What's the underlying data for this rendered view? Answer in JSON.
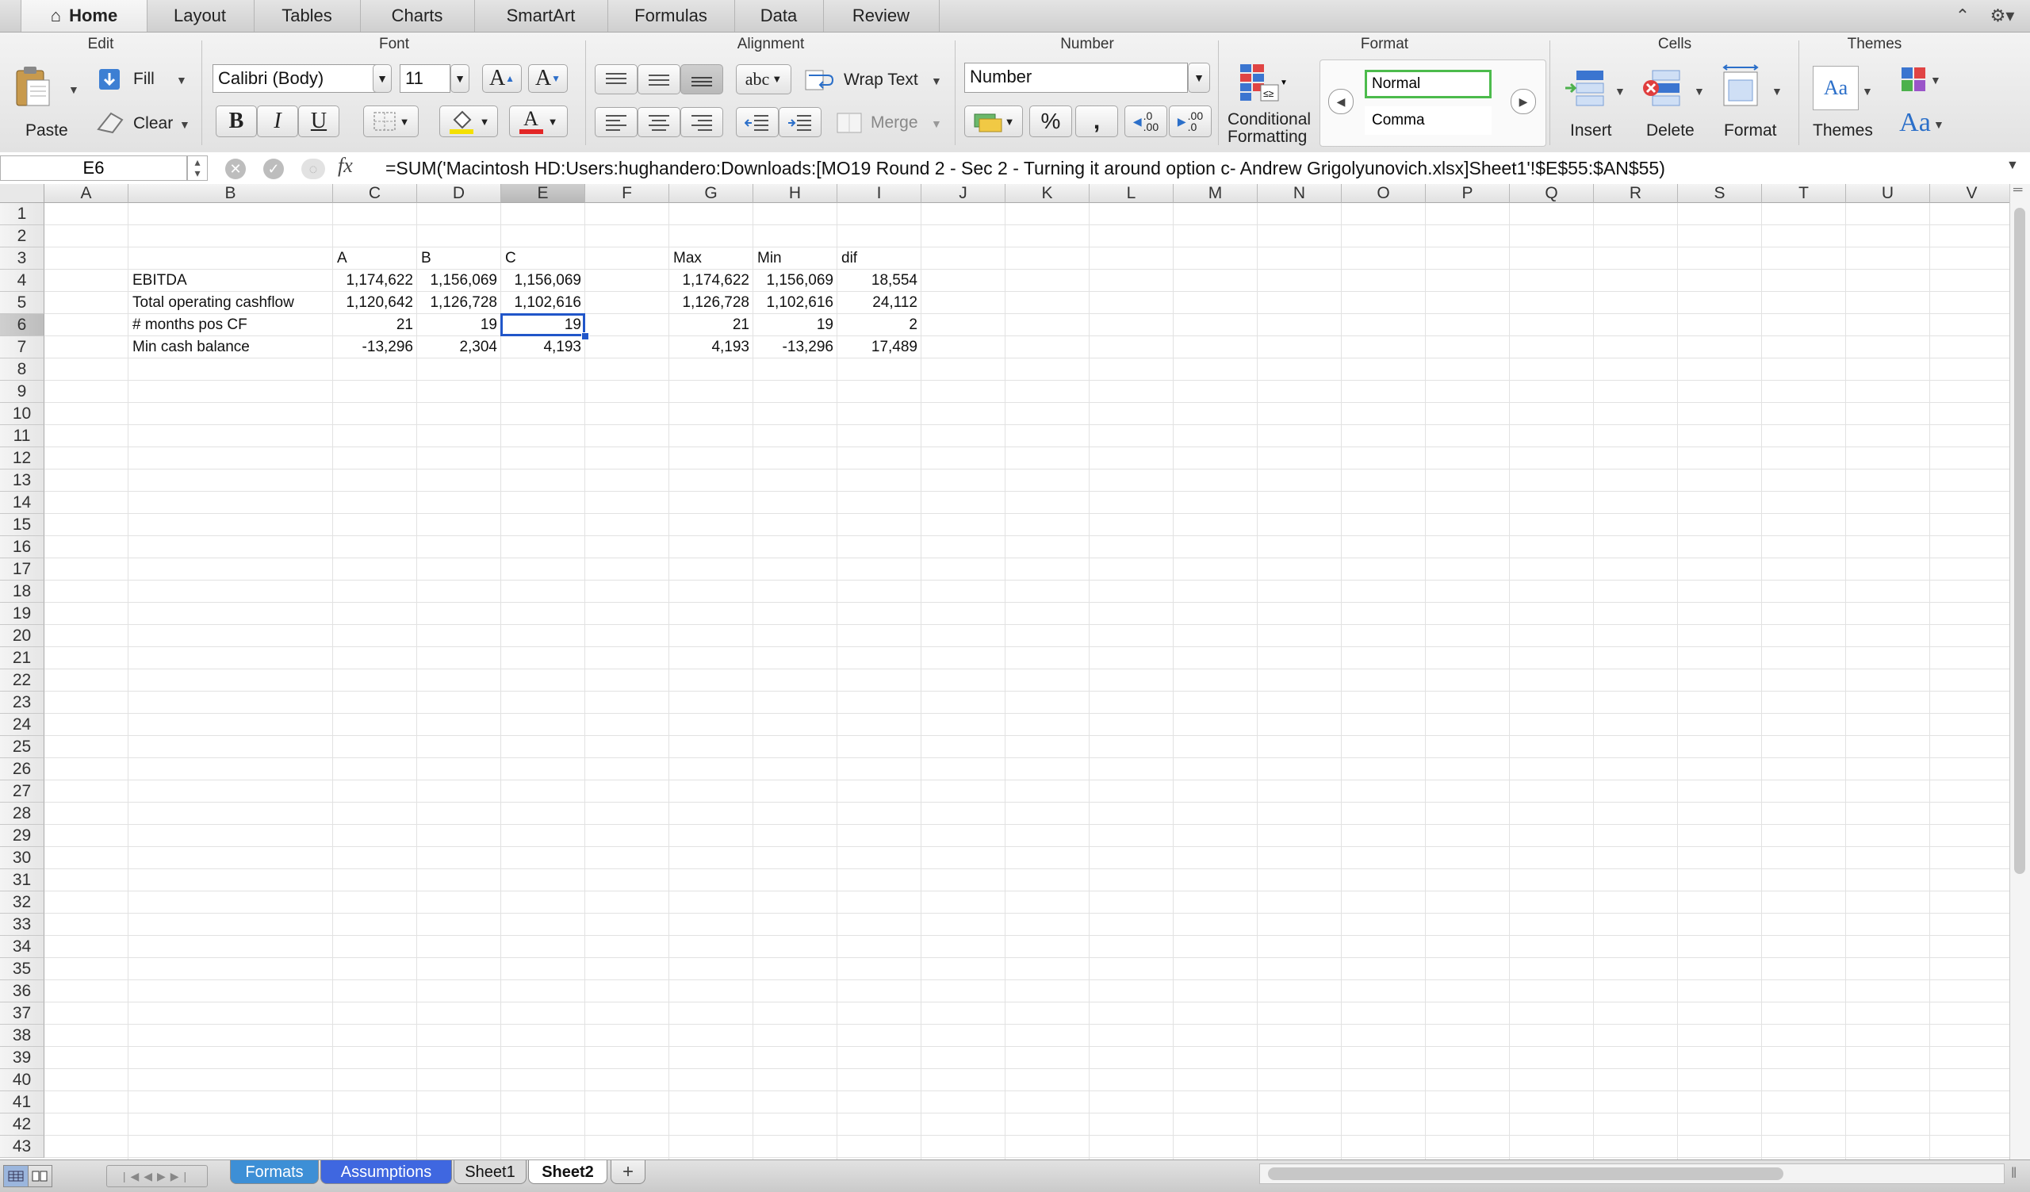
{
  "ribbon_tabs": [
    "Home",
    "Layout",
    "Tables",
    "Charts",
    "SmartArt",
    "Formulas",
    "Data",
    "Review"
  ],
  "active_tab": "Home",
  "groups": {
    "edit": {
      "title": "Edit",
      "paste": "Paste",
      "fill": "Fill",
      "clear": "Clear"
    },
    "font": {
      "title": "Font",
      "font_name": "Calibri (Body)",
      "font_size": "11",
      "bold": "B",
      "italic": "I",
      "underline": "U",
      "grow": "A",
      "shrink": "A",
      "font_color_letter": "A"
    },
    "alignment": {
      "title": "Alignment",
      "wrap_text": "Wrap Text",
      "merge": "Merge",
      "orientation": "abc"
    },
    "number": {
      "title": "Number",
      "format": "Number",
      "percent": "%",
      "comma": ",",
      "inc_decimal": ".0\n.00",
      "dec_decimal": ".00\n.0"
    },
    "format": {
      "title": "Format",
      "conditional": "Conditional",
      "formatting": "Formatting",
      "style_normal": "Normal",
      "style_comma": "Comma"
    },
    "cells": {
      "title": "Cells",
      "insert": "Insert",
      "delete": "Delete",
      "format": "Format"
    },
    "themes": {
      "title": "Themes",
      "themes": "Themes",
      "sample": "Aa",
      "fonts": "Aa"
    }
  },
  "formula_bar": {
    "name_box": "E6",
    "fx": "fx",
    "formula": "=SUM('Macintosh HD:Users:hughandero:Downloads:[MO19 Round 2 - Sec 2 - Turning it around option c- Andrew Grigolyunovich.xlsx]Sheet1'!$E$55:$AN$55)"
  },
  "columns": [
    "A",
    "B",
    "C",
    "D",
    "E",
    "F",
    "G",
    "H",
    "I",
    "J",
    "K",
    "L",
    "M",
    "N",
    "O",
    "P",
    "Q",
    "R",
    "S",
    "T",
    "U",
    "V"
  ],
  "row_count": 43,
  "selected_cell": {
    "col": "E",
    "row": 6
  },
  "cells": {
    "C3": "A",
    "D3": "B",
    "E3": "C",
    "G3": "Max",
    "H3": "Min",
    "I3": "dif",
    "B4": "EBITDA",
    "C4": "1,174,622",
    "D4": "1,156,069",
    "E4": "1,156,069",
    "G4": "1,174,622",
    "H4": "1,156,069",
    "I4": "18,554",
    "B5": "Total operating cashflow",
    "C5": "1,120,642",
    "D5": "1,126,728",
    "E5": "1,102,616",
    "G5": "1,126,728",
    "H5": "1,102,616",
    "I5": "24,112",
    "B6": "# months pos CF",
    "C6": "21",
    "D6": "19",
    "E6": "19",
    "G6": "21",
    "H6": "19",
    "I6": "2",
    "B7": "Min cash balance",
    "C7": "-13,296",
    "D7": "2,304",
    "E7": "4,193",
    "G7": "4,193",
    "H7": "-13,296",
    "I7": "17,489"
  },
  "text_cells": [
    "C3",
    "D3",
    "E3",
    "G3",
    "H3",
    "I3",
    "B4",
    "B5",
    "B6",
    "B7"
  ],
  "sheet_tabs": [
    {
      "label": "Formats",
      "color": "#3d8fd6"
    },
    {
      "label": "Assumptions",
      "color": "#3f67e0"
    },
    {
      "label": "Sheet1",
      "color": "#dcdcdc"
    },
    {
      "label": "Sheet2",
      "color": "#ffffff"
    }
  ],
  "add_sheet": "+",
  "active_sheet": "Sheet2"
}
